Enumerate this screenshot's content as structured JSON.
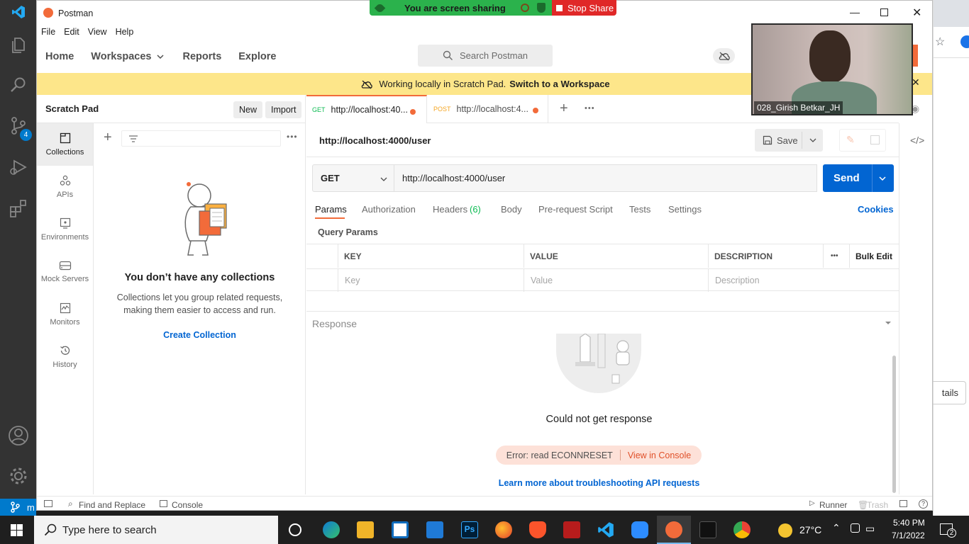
{
  "vscode": {
    "badge": "4",
    "status_text": "m"
  },
  "share_bar": {
    "sharing_text": "You are screen sharing",
    "stop_label": "Stop Share"
  },
  "window": {
    "title": "Postman"
  },
  "menu": [
    "File",
    "Edit",
    "View",
    "Help"
  ],
  "nav": {
    "home": "Home",
    "workspaces": "Workspaces",
    "reports": "Reports",
    "explore": "Explore"
  },
  "search": {
    "placeholder": "Search Postman"
  },
  "banner": {
    "text": "Working locally in Scratch Pad.",
    "link": "Switch to a Workspace"
  },
  "sidebar": {
    "title": "Scratch Pad",
    "new_label": "New",
    "import_label": "Import",
    "items": [
      {
        "label": "Collections",
        "icon": "collections-icon"
      },
      {
        "label": "APIs",
        "icon": "apis-icon"
      },
      {
        "label": "Environments",
        "icon": "environments-icon"
      },
      {
        "label": "Mock Servers",
        "icon": "mock-servers-icon"
      },
      {
        "label": "Monitors",
        "icon": "monitors-icon"
      },
      {
        "label": "History",
        "icon": "history-icon"
      }
    ],
    "empty_title": "You don’t have any collections",
    "empty_desc_1": "Collections let you group related requests,",
    "empty_desc_2": "making them easier to access and run.",
    "create_label": "Create Collection"
  },
  "tabs": [
    {
      "method": "GET",
      "label": "http://localhost:40...",
      "method_color": "#0cbb52"
    },
    {
      "method": "POST",
      "label": "http://localhost:4...",
      "method_color": "#f5a623"
    }
  ],
  "request": {
    "name": "http://localhost:4000/user",
    "save_label": "Save",
    "method": "GET",
    "url": "http://localhost:4000/user",
    "send_label": "Send",
    "tabs": [
      "Params",
      "Authorization",
      "Headers",
      "Body",
      "Pre-request Script",
      "Tests",
      "Settings"
    ],
    "headers_count": "(6)",
    "cookies_label": "Cookies",
    "query_params_label": "Query Params",
    "columns": [
      "KEY",
      "VALUE",
      "DESCRIPTION"
    ],
    "bulk_edit_label": "Bulk Edit",
    "placeholders": {
      "key": "Key",
      "value": "Value",
      "description": "Description"
    }
  },
  "response": {
    "title": "Response",
    "message": "Could not get response",
    "error": "Error: read ECONNRESET",
    "view_console": "View in Console",
    "learn_more": "Learn more about troubleshooting API requests"
  },
  "statusbar": {
    "find_replace": "Find and Replace",
    "console": "Console",
    "runner": "Runner",
    "trash": "Trash"
  },
  "video": {
    "name": "028_Girish Betkar_JH"
  },
  "bg_window": {
    "button_fragment": "tails"
  },
  "taskbar": {
    "search_placeholder": "Type here to search",
    "temperature": "27°C",
    "time": "5:40 PM",
    "date": "7/1/2022",
    "notifications": "2"
  },
  "colors": {
    "accent": "#0265d2",
    "orange": "#f26b3a",
    "banner": "#fde68a",
    "vscode_blue": "#007acc"
  }
}
